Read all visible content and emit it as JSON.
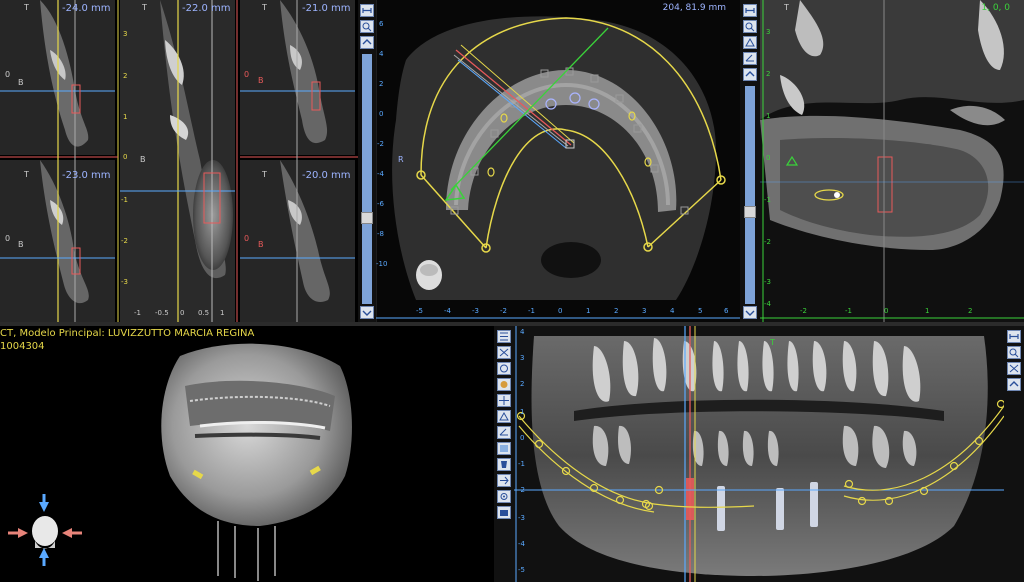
{
  "cross_sections": {
    "slice_labels": [
      "-24.0 mm",
      "-22.0 mm",
      "-21.0 mm",
      "-23.0 mm",
      "-20.0 mm"
    ],
    "top_marker": "T",
    "bottom_marker": "B",
    "zero_marker": "0",
    "scale_ticks": [
      "3",
      "2",
      "1",
      "0",
      "-1",
      "-2",
      "-3"
    ],
    "bottom_ticks": [
      "-1",
      "-0.5",
      "0",
      "0.5",
      "1"
    ]
  },
  "axial": {
    "coord_readout": "204, 81.9 mm",
    "side_marker": "R",
    "left_ticks": [
      "6",
      "4",
      "2",
      "0",
      "-2",
      "-4",
      "-6",
      "-8",
      "-10"
    ],
    "bottom_ticks": [
      "-5",
      "-4",
      "-3",
      "-2",
      "-1",
      "0",
      "1",
      "2",
      "3",
      "4",
      "5",
      "6"
    ]
  },
  "sagittal": {
    "coord_readout": "1, 0, 0",
    "top_marker": "T",
    "left_ticks": [
      "3",
      "2",
      "1",
      "0",
      "-1",
      "-2",
      "-3",
      "-4"
    ],
    "bottom_ticks": [
      "-2",
      "-1",
      "0",
      "1",
      "2"
    ]
  },
  "model_3d": {
    "caption_line1": "CT, Modelo Principal: LUVIZZUTTO MARCIA REGINA",
    "caption_line2": "1004304"
  },
  "panoramic": {
    "top_marker": "T",
    "left_ticks": [
      "4",
      "3",
      "2",
      "1",
      "0",
      "-1",
      "-2",
      "-3",
      "-4",
      "-5"
    ]
  },
  "toolbars": {
    "axial_right": [
      "fit-icon",
      "zoom-icon",
      "measure-icon",
      "angle-icon",
      "scroll-up-icon"
    ],
    "sagittal_left": [
      "fit-icon",
      "zoom-icon",
      "measure-icon",
      "angle-icon",
      "scroll-up-icon"
    ],
    "panoramic_left": [
      "select-icon",
      "draw-curve-icon",
      "nerve-icon",
      "implant-icon",
      "crosshair-icon",
      "measure-icon",
      "angle-icon",
      "density-icon",
      "tooth-icon",
      "export-icon"
    ],
    "panoramic_right": [
      "fit-icon",
      "zoom-icon",
      "window-icon",
      "scroll-up-icon"
    ]
  },
  "colors": {
    "accent_yellow": "#e6d84a",
    "accent_blue": "#5aa9ff",
    "accent_red": "#e85a5a",
    "green": "#3ad23a",
    "scroll_blue": "#7ea3d8"
  }
}
